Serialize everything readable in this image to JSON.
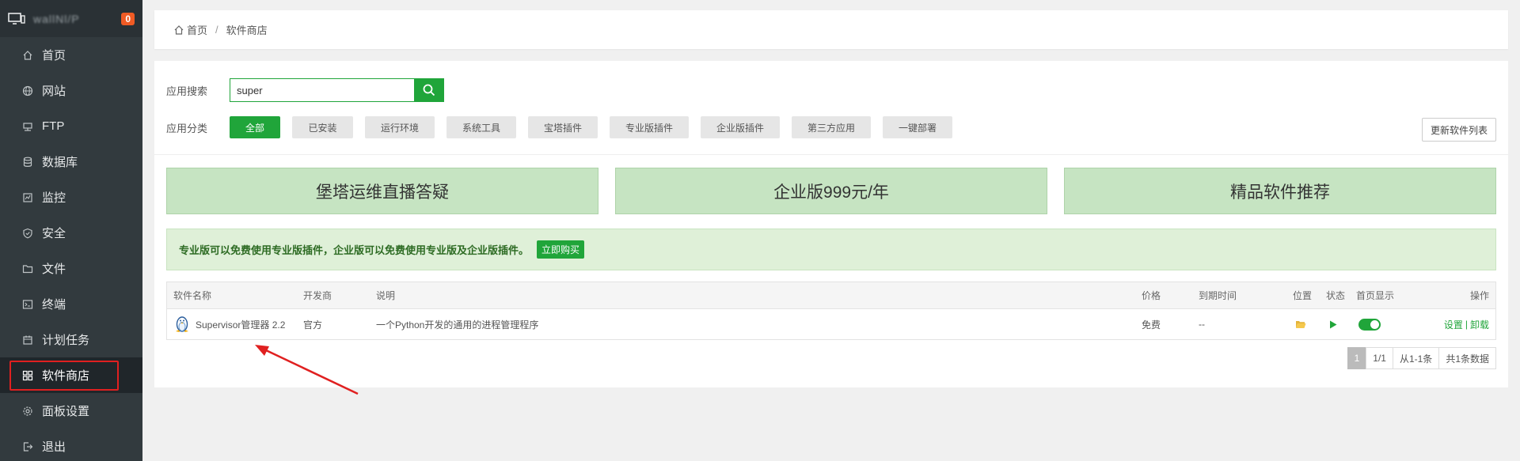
{
  "sidebar": {
    "server_name": "wallNl/P",
    "badge": "0",
    "items": [
      {
        "label": "首页"
      },
      {
        "label": "网站"
      },
      {
        "label": "FTP"
      },
      {
        "label": "数据库"
      },
      {
        "label": "监控"
      },
      {
        "label": "安全"
      },
      {
        "label": "文件"
      },
      {
        "label": "终端"
      },
      {
        "label": "计划任务"
      },
      {
        "label": "软件商店"
      },
      {
        "label": "面板设置"
      },
      {
        "label": "退出"
      }
    ]
  },
  "breadcrumb": {
    "home": "首页",
    "sep": "/",
    "current": "软件商店"
  },
  "search": {
    "label": "应用搜索",
    "value": "super"
  },
  "categories": {
    "label": "应用分类",
    "items": [
      "全部",
      "已安装",
      "运行环境",
      "系统工具",
      "宝塔插件",
      "专业版插件",
      "企业版插件",
      "第三方应用",
      "一键部署"
    ],
    "active": "全部"
  },
  "update_button": "更新软件列表",
  "banners": [
    "堡塔运维直播答疑",
    "企业版999元/年",
    "精品软件推荐"
  ],
  "notice": {
    "text": "专业版可以免费使用专业版插件，企业版可以免费使用专业版及企业版插件。",
    "button": "立即购买"
  },
  "table": {
    "headers": {
      "name": "软件名称",
      "dev": "开发商",
      "desc": "说明",
      "price": "价格",
      "expire": "到期时间",
      "location": "位置",
      "status": "状态",
      "home": "首页显示",
      "ops": "操作"
    },
    "rows": [
      {
        "name": "Supervisor管理器 2.2",
        "dev": "官方",
        "desc": "一个Python开发的通用的进程管理程序",
        "price": "免费",
        "expire": "--",
        "ops_settings": "设置",
        "ops_sep": "|",
        "ops_uninstall": "卸载",
        "home_display": true
      }
    ]
  },
  "pagination": {
    "current": "1",
    "pages": "1/1",
    "range": "从1-1条",
    "total": "共1条数据"
  },
  "colors": {
    "accent": "#20a53a",
    "sidebar_bg": "#323a3e",
    "badge": "#f05b24",
    "annotation": "#e02020"
  }
}
